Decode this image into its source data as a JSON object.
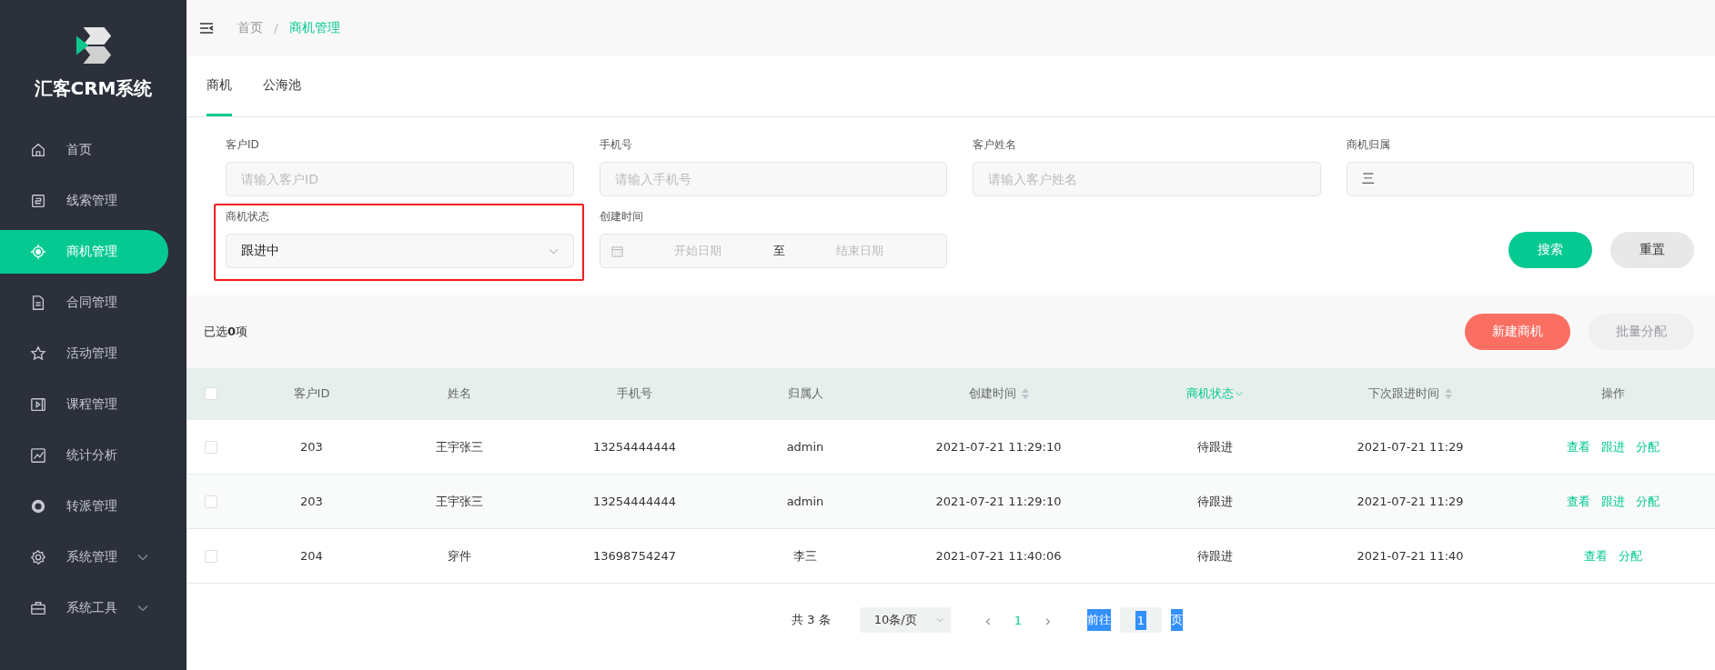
{
  "sidebar": {
    "logo_text": "汇客CRM系统",
    "items": [
      {
        "label": "首页",
        "selected": false,
        "expandable": false
      },
      {
        "label": "线索管理",
        "selected": false,
        "expandable": false
      },
      {
        "label": "商机管理",
        "selected": true,
        "expandable": false
      },
      {
        "label": "合同管理",
        "selected": false,
        "expandable": false
      },
      {
        "label": "活动管理",
        "selected": false,
        "expandable": false
      },
      {
        "label": "课程管理",
        "selected": false,
        "expandable": false
      },
      {
        "label": "统计分析",
        "selected": false,
        "expandable": false
      },
      {
        "label": "转派管理",
        "selected": false,
        "expandable": false
      },
      {
        "label": "系统管理",
        "selected": false,
        "expandable": true
      },
      {
        "label": "系统工具",
        "selected": false,
        "expandable": true
      }
    ]
  },
  "breadcrumb_separator": "/",
  "breadcrumb": [
    {
      "label": "首页",
      "current": false
    },
    {
      "label": "商机管理",
      "current": true
    }
  ],
  "tabs": [
    {
      "label": "商机",
      "selected": true
    },
    {
      "label": "公海池",
      "selected": false
    }
  ],
  "filters": [
    {
      "label": "客户ID",
      "kind": "input",
      "placeholder": "请输入客户ID",
      "highlighted": false
    },
    {
      "label": "手机号",
      "kind": "input",
      "placeholder": "请输入手机号",
      "highlighted": false
    },
    {
      "label": "客户姓名",
      "kind": "input",
      "placeholder": "请输入客户姓名",
      "highlighted": false
    },
    {
      "label": "商机归属",
      "kind": "input",
      "value": "三",
      "highlighted": false
    },
    {
      "label": "商机状态",
      "kind": "select",
      "value": "跟进中",
      "highlighted": true
    },
    {
      "label": "创建时间",
      "kind": "daterange",
      "start_placeholder": "开始日期",
      "separator": "至",
      "end_placeholder": "结束日期",
      "highlighted": false
    }
  ],
  "filter_buttons": [
    {
      "label": "搜索",
      "kind": "primary"
    },
    {
      "label": "重置",
      "kind": "default"
    }
  ],
  "selection_text": "已选**0**项",
  "actions": [
    {
      "label": "新建商机",
      "disabled": false
    },
    {
      "label": "批量分配",
      "disabled": true
    }
  ],
  "table": {
    "header_checked": false,
    "columns": [
      {
        "label": "客户ID",
        "sortable": false,
        "filterable": false,
        "active": false
      },
      {
        "label": "姓名",
        "sortable": false,
        "filterable": false,
        "active": false
      },
      {
        "label": "手机号",
        "sortable": false,
        "filterable": false,
        "active": false
      },
      {
        "label": "归属人",
        "sortable": false,
        "filterable": false,
        "active": false
      },
      {
        "label": "创建时间",
        "sortable": true,
        "filterable": false,
        "active": false
      },
      {
        "label": "商机状态",
        "sortable": false,
        "filterable": true,
        "active": true
      },
      {
        "label": "下次跟进时间",
        "sortable": true,
        "filterable": false,
        "active": false
      },
      {
        "label": "操作",
        "sortable": false,
        "filterable": false,
        "active": false
      }
    ],
    "rows": [
      {
        "checked": false,
        "cells": [
          "203",
          "王宇张三",
          "13254444444",
          "admin",
          "2021-07-21 11:29:10",
          "待跟进",
          "2021-07-21 11:29"
        ],
        "actions": [
          "查看",
          "跟进",
          "分配"
        ]
      },
      {
        "checked": false,
        "cells": [
          "203",
          "王宇张三",
          "13254444444",
          "admin",
          "2021-07-21 11:29:10",
          "待跟进",
          "2021-07-21 11:29"
        ],
        "actions": [
          "查看",
          "跟进",
          "分配"
        ]
      },
      {
        "checked": false,
        "cells": [
          "204",
          "穿件",
          "13698754247",
          "李三",
          "2021-07-21 11:40:06",
          "待跟进",
          "2021-07-21 11:40"
        ],
        "actions": [
          "查看",
          "分配"
        ]
      }
    ]
  },
  "pagination": {
    "total": "共 3 条",
    "page_size": "10条/页",
    "prev": "‹",
    "next": "›",
    "pages": [
      {
        "label": "1",
        "selected": true
      }
    ],
    "goto_label": "前往",
    "goto_value": "1",
    "goto_suffix": "页",
    "goto_highlighted": true
  }
}
